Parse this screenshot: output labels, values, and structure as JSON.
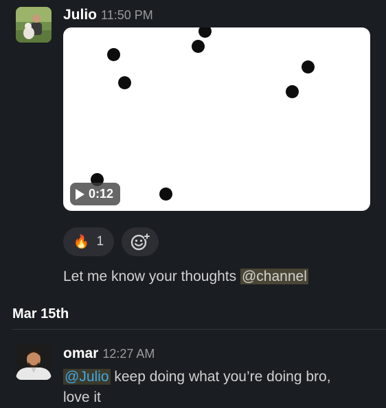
{
  "messages": [
    {
      "author": "Julio",
      "time": "11:50 PM",
      "video": {
        "duration": "0:12"
      },
      "reactions": [
        {
          "emoji": "🔥",
          "count": "1"
        }
      ],
      "text": {
        "before": "Let me know your thoughts ",
        "mention": "@channel"
      }
    },
    {
      "author": "omar",
      "time": "12:27 AM",
      "text": {
        "mention": "@Julio",
        "line1": " keep doing what you’re doing bro,",
        "line2": "love it"
      }
    }
  ],
  "date_divider": "Mar 15th",
  "icons": [
    "play-icon",
    "fire-emoji",
    "add-reaction-icon"
  ],
  "colors": {
    "background": "#1a1d21",
    "mention_bg": "#4a4534",
    "mention_user": "#43a6e0"
  }
}
